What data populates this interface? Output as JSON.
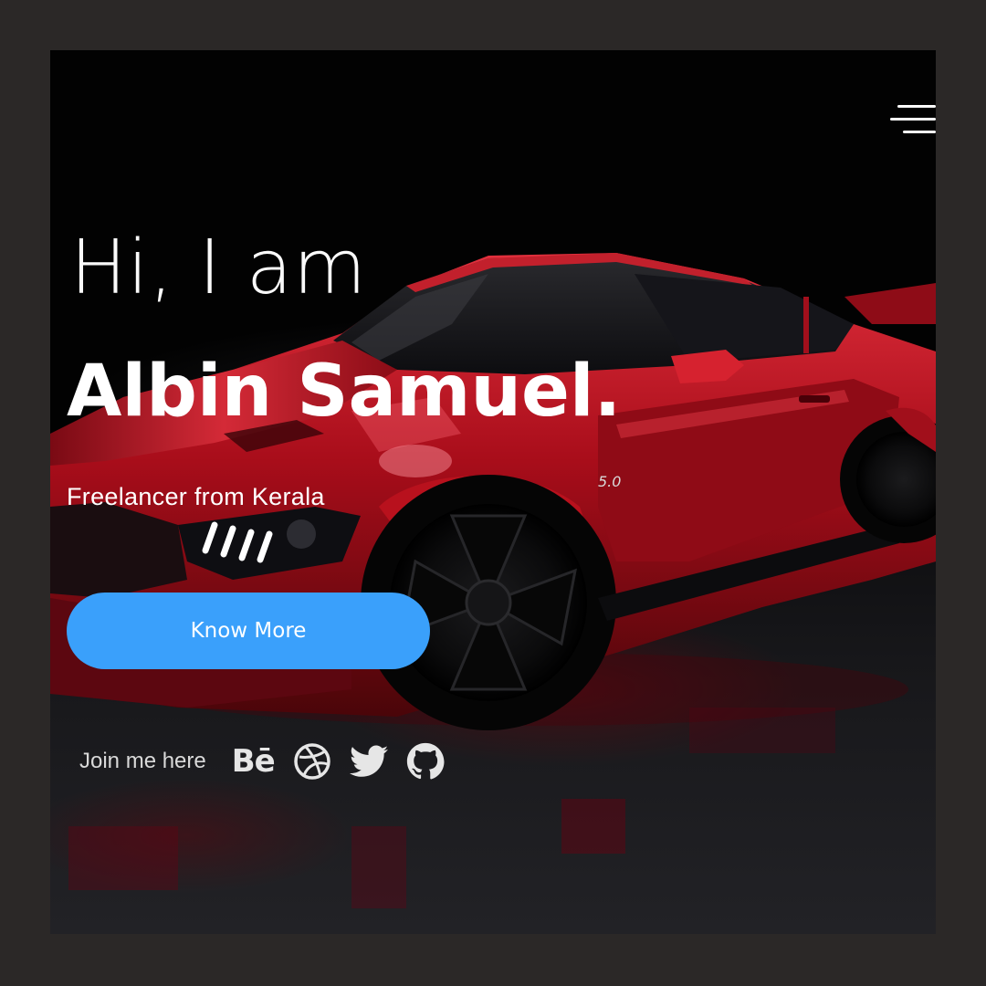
{
  "hero": {
    "greeting": "Hi, I am",
    "name": "Albin Samuel.",
    "tagline": "Freelancer from Kerala",
    "cta_label": "Know More"
  },
  "social": {
    "label": "Join me here",
    "behance_text": "Bē",
    "icons": [
      "behance-icon",
      "dribbble-icon",
      "twitter-icon",
      "github-icon"
    ]
  },
  "nav": {
    "menu_icon": "hamburger-menu-icon"
  },
  "colors": {
    "background": "#020202",
    "outer_border": "#2b2827",
    "accent": "#3aa0fb",
    "text": "#ffffff",
    "car_red": "#b3121f"
  }
}
